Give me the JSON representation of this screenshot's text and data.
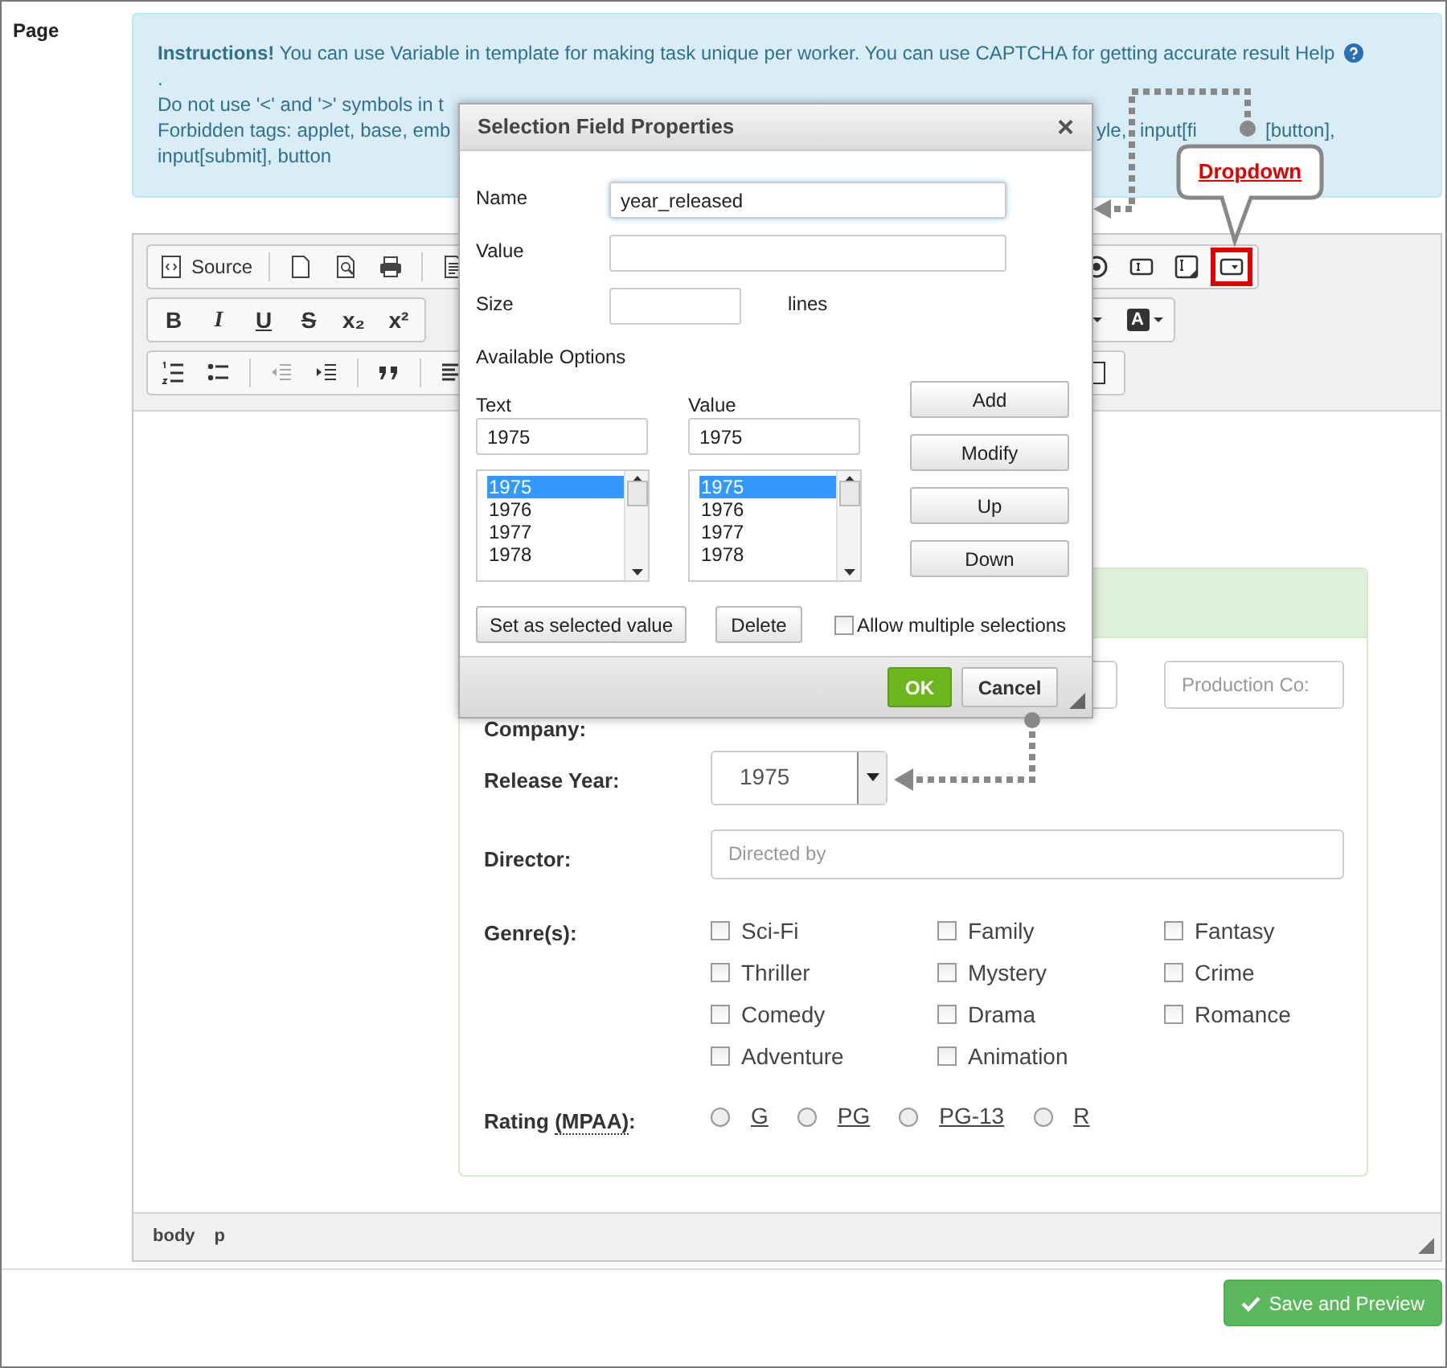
{
  "page_label": "Page",
  "instructions": [
    {
      "kind": "with-help",
      "text": "**Instructions!** You can use Variable in template for making task unique per worker. You can use CAPTCHA for getting accurate result Help"
    },
    {
      "kind": "plain",
      "text": "."
    },
    {
      "kind": "plain",
      "text": "Do not use '<' and '>' symbols in t"
    },
    {
      "kind": "split",
      "text": "Forbidden tags: applet, base, emb",
      "pieces": [
        "yle,",
        "input[fi",
        "[button],"
      ]
    },
    {
      "kind": "plain",
      "text": "input[submit], button"
    }
  ],
  "toolbar": [
    {
      "left": [
        {
          "kind": "source",
          "label": "Source"
        },
        {
          "kind": "separator"
        },
        {
          "kind": "new-page"
        },
        {
          "kind": "preview"
        },
        {
          "kind": "print"
        },
        {
          "kind": "separator"
        },
        {
          "kind": "template"
        }
      ],
      "right": [
        {
          "kind": "radio",
          "highlighted": false
        },
        {
          "kind": "text-field",
          "highlighted": false
        },
        {
          "kind": "textarea",
          "highlighted": false
        },
        {
          "kind": "select",
          "highlighted": true
        }
      ]
    },
    {
      "left": [
        {
          "kind": "glyph",
          "text": "B"
        },
        {
          "kind": "glyph",
          "text": "I"
        },
        {
          "kind": "glyph",
          "text": "U"
        },
        {
          "kind": "glyph",
          "text": "S"
        },
        {
          "kind": "glyph",
          "text": "x₂"
        },
        {
          "kind": "glyph",
          "text": "x²"
        }
      ],
      "right": [
        {
          "kind": "caret"
        },
        {
          "kind": "text-color",
          "text": "A"
        }
      ]
    },
    {
      "left": [
        {
          "kind": "numbered-list",
          "disabled": false
        },
        {
          "kind": "bullet-list",
          "disabled": false
        },
        {
          "kind": "separator"
        },
        {
          "kind": "outdent",
          "disabled": true
        },
        {
          "kind": "indent",
          "disabled": false
        },
        {
          "kind": "separator"
        },
        {
          "kind": "quote",
          "disabled": false
        },
        {
          "kind": "separator"
        },
        {
          "kind": "align-left",
          "disabled": false
        }
      ],
      "right": [
        {
          "kind": "tall-box"
        }
      ]
    }
  ],
  "form": {
    "company_label": "Company:",
    "production_placeholder": "Production Co:",
    "release_label": "Release Year:",
    "release_value": "1975",
    "director_label": "Director:",
    "director_placeholder": "Directed by",
    "genres_label": "Genre(s):",
    "genres": [
      {
        "label": "Sci-Fi",
        "checked": false
      },
      {
        "label": "Family",
        "checked": false
      },
      {
        "label": "Fantasy",
        "checked": false
      },
      {
        "label": "Thriller",
        "checked": false
      },
      {
        "label": "Mystery",
        "checked": false
      },
      {
        "label": "Crime",
        "checked": false
      },
      {
        "label": "Comedy",
        "checked": false
      },
      {
        "label": "Drama",
        "checked": false
      },
      {
        "label": "Romance",
        "checked": false
      },
      {
        "label": "Adventure",
        "checked": false
      },
      {
        "label": "Animation",
        "checked": false
      }
    ],
    "rating_label": "Rating ",
    "rating_abbr": "(MPAA)",
    "rating_colon": ":",
    "ratings": [
      {
        "label": "G",
        "selected": false
      },
      {
        "label": "PG",
        "selected": false
      },
      {
        "label": "PG-13",
        "selected": false
      },
      {
        "label": "R",
        "selected": false
      }
    ]
  },
  "status_path": [
    "body",
    "p"
  ],
  "save_button": "Save and Preview",
  "dialog": {
    "title": "Selection Field Properties",
    "close": "×",
    "name_label": "Name",
    "name_value": "year_released",
    "value_label": "Value",
    "size_label": "Size",
    "lines_label": "lines",
    "available_options": "Available Options",
    "text_label": "Text",
    "text_value": "1975",
    "option_value_label": "Value",
    "option_value": "1975",
    "text_options": [
      {
        "label": "1975",
        "selected": true
      },
      {
        "label": "1976",
        "selected": false
      },
      {
        "label": "1977",
        "selected": false
      },
      {
        "label": "1978",
        "selected": false
      }
    ],
    "value_options": [
      {
        "label": "1975",
        "selected": true
      },
      {
        "label": "1976",
        "selected": false
      },
      {
        "label": "1977",
        "selected": false
      },
      {
        "label": "1978",
        "selected": false
      }
    ],
    "side_buttons": [
      "Add",
      "Modify",
      "Up",
      "Down"
    ],
    "set_selected": "Set as selected value",
    "delete": "Delete",
    "allow_multiple": {
      "label": "Allow multiple selections",
      "checked": false
    },
    "ok": "OK",
    "cancel": "Cancel"
  },
  "callout": {
    "label": "Dropdown"
  }
}
